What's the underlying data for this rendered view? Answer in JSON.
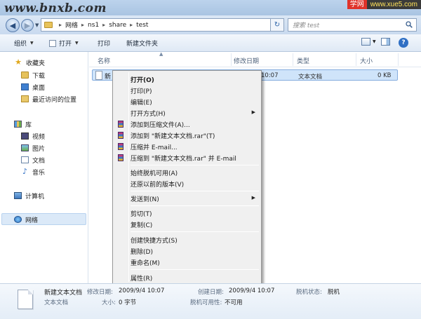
{
  "watermark": {
    "left": "www.bnxb.com",
    "right_a": "学网",
    "right_b": "www.xue5.com"
  },
  "address": {
    "crumbs": [
      "网络",
      "ns1",
      "share",
      "test"
    ],
    "refresh_glyph": "↻",
    "search_placeholder": "搜索 test"
  },
  "toolbar": {
    "organize": "组织",
    "open": "打开",
    "print": "打印",
    "new_folder": "新建文件夹",
    "help_glyph": "?"
  },
  "nav": {
    "favorites": "收藏夹",
    "downloads": "下载",
    "desktop": "桌面",
    "recent": "最近访问的位置",
    "libraries": "库",
    "videos": "视频",
    "pictures": "图片",
    "documents": "文档",
    "music": "音乐",
    "computer": "计算机",
    "network": "网络"
  },
  "columns": {
    "name": "名称",
    "modified": "修改日期",
    "type": "类型",
    "size": "大小"
  },
  "file": {
    "name_trunc": "新",
    "modified_trunc": "10:07",
    "type": "文本文档",
    "size": "0 KB"
  },
  "context_menu": {
    "open": "打开(O)",
    "print": "打印(P)",
    "edit": "编辑(E)",
    "open_with": "打开方式(H)",
    "add_archive": "添加到压缩文件(A)...",
    "add_rar": "添加到 \"新建文本文档.rar\"(T)",
    "compress_email": "压缩并 E-mail...",
    "compress_rar_email": "压缩到 \"新建文本文档.rar\" 并 E-mail",
    "always_offline": "始终脱机可用(A)",
    "restore_prev": "还原以前的版本(V)",
    "send_to": "发送到(N)",
    "cut": "剪切(T)",
    "copy": "复制(C)",
    "create_shortcut": "创建快捷方式(S)",
    "delete": "删除(D)",
    "rename": "重命名(M)",
    "properties": "属性(R)"
  },
  "details": {
    "name": "新建文本文档",
    "type": "文本文档",
    "modified_label": "修改日期:",
    "modified_value": "2009/9/4 10:07",
    "size_label": "大小:",
    "size_value": "0 字节",
    "created_label": "创建日期:",
    "created_value": "2009/9/4 10:07",
    "offline_avail_label": "脱机可用性:",
    "offline_avail_value": "不可用",
    "offline_status_label": "脱机状态:",
    "offline_status_value": "脱机"
  }
}
